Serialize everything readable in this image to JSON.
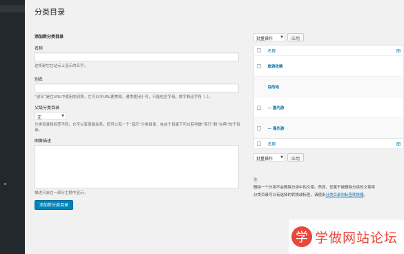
{
  "page": {
    "title": "分类目录"
  },
  "form": {
    "heading": "添加新分类目录",
    "name_label": "名称",
    "name_value": "",
    "name_desc": "这将是它在站点上显示的名字。",
    "slug_label": "别名",
    "slug_value": "",
    "slug_desc": "“别名”是在URL中使用的别称，它可以令URL更美观。通常使用小写，只能包含字母，数字和连字符（-）。",
    "parent_label": "父级分类目录",
    "parent_value": "无",
    "parent_desc": "分类目录和标签不同，它可以有层级关系。您可以有一个“音乐”分类目录，在这个目录下可以有叫做“流行”和“古典”的子目录。",
    "desc_label": "图像描述",
    "desc_value": "",
    "desc_help": "描述只会在一部分主题中显示。",
    "submit": "添加新分类目录"
  },
  "list": {
    "bulk_action": "批量操作",
    "apply": "应用",
    "col_name": "名称",
    "col_right": "图",
    "rows": [
      {
        "name": "旅游攻略",
        "has_cb": true
      },
      {
        "name": "目的地",
        "has_cb": false
      },
      {
        "name": "— 国内游",
        "has_cb": true
      },
      {
        "name": "— 海外游",
        "has_cb": true
      }
    ]
  },
  "notes": {
    "title": "注:",
    "line1": "删除一个分类不会删除分类中的文章。然而，仅属于被删除分类的文章将",
    "line2_pre": "分类目录可以有选择的转换成标签，请使用",
    "line2_link": "分类目录到标签转换器",
    "line2_post": "。"
  },
  "watermark": {
    "badge": "学",
    "text": "学做网站论坛"
  },
  "colors": {
    "primary": "#0085ba",
    "link": "#0073aa",
    "sidebar": "#23282d",
    "watermark": "#e8473a"
  }
}
